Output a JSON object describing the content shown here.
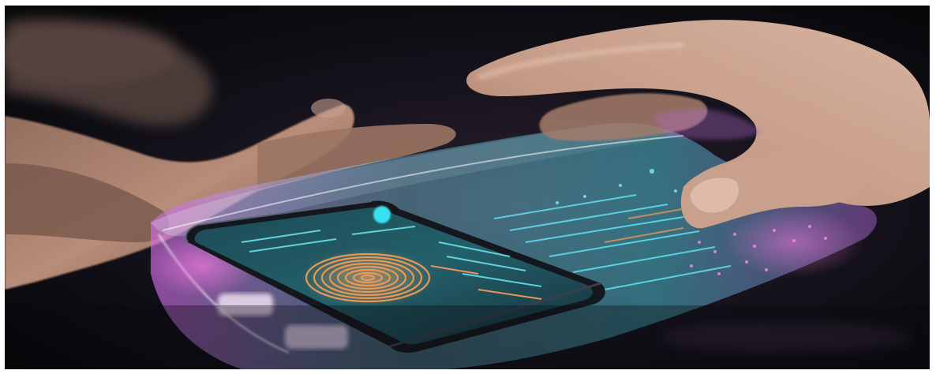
{
  "image": {
    "kind": "photograph",
    "subject": [
      "hand-left",
      "hand-right",
      "smartphone",
      "fingerprint-icon",
      "holographic-panel"
    ],
    "colors": {
      "background": "#0b0b10",
      "skin": "#c9a08a",
      "hologram_cyan": "#35d6e8",
      "hologram_magenta": "#c65ad8",
      "fingerprint": "#e48a4a",
      "phone_body": "#1a1d24"
    }
  }
}
